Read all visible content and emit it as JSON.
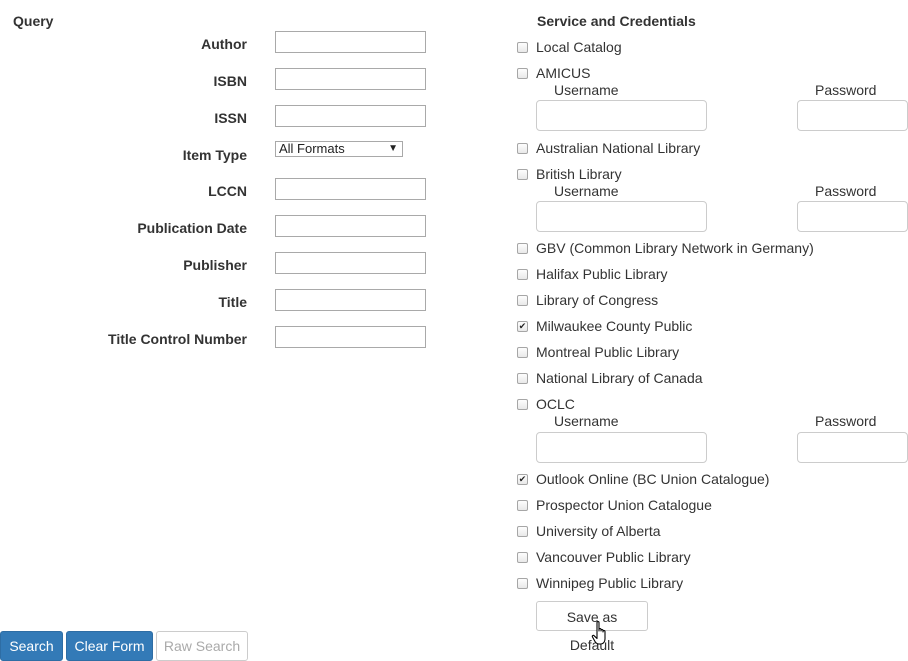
{
  "query": {
    "title": "Query",
    "fields": [
      {
        "label": "Author",
        "value": ""
      },
      {
        "label": "ISBN",
        "value": ""
      },
      {
        "label": "ISSN",
        "value": ""
      },
      {
        "label": "Item Type",
        "value": "All Formats"
      },
      {
        "label": "LCCN",
        "value": ""
      },
      {
        "label": "Publication Date",
        "value": ""
      },
      {
        "label": "Publisher",
        "value": ""
      },
      {
        "label": "Title",
        "value": ""
      },
      {
        "label": "Title Control Number",
        "value": ""
      }
    ]
  },
  "services": {
    "title": "Service and Credentials",
    "username_label": "Username",
    "password_label": "Password",
    "items": [
      {
        "name": "Local Catalog",
        "checked": false
      },
      {
        "name": "AMICUS",
        "checked": false
      },
      {
        "name": "Australian National Library",
        "checked": false
      },
      {
        "name": "British Library",
        "checked": false
      },
      {
        "name": "GBV (Common Library Network in Germany)",
        "checked": false
      },
      {
        "name": "Halifax Public Library",
        "checked": false
      },
      {
        "name": "Library of Congress",
        "checked": false
      },
      {
        "name": "Milwaukee County Public",
        "checked": true
      },
      {
        "name": "Montreal Public Library",
        "checked": false
      },
      {
        "name": "National Library of Canada",
        "checked": false
      },
      {
        "name": "OCLC",
        "checked": false
      },
      {
        "name": "Outlook Online (BC Union Catalogue)",
        "checked": true
      },
      {
        "name": "Prospector Union Catalogue",
        "checked": false
      },
      {
        "name": "University of Alberta",
        "checked": false
      },
      {
        "name": "Vancouver Public Library",
        "checked": false
      },
      {
        "name": "Winnipeg Public Library",
        "checked": false
      }
    ],
    "save_default_label": "Save as Default"
  },
  "actions": {
    "search_label": "Search",
    "clear_label": "Clear Form",
    "raw_search_label": "Raw Search"
  },
  "check_glyph": "✔",
  "caret_glyph": "▼",
  "colors": {
    "primary": "#337ab7",
    "text": "#333333"
  }
}
